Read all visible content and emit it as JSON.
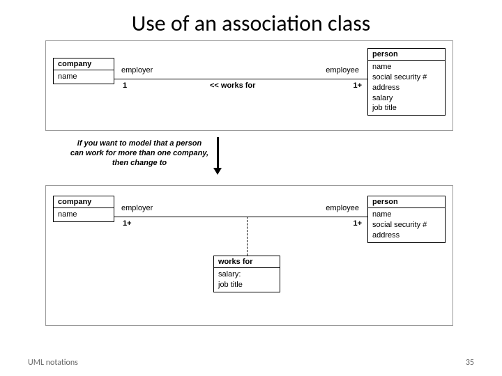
{
  "title": "Use of an association class",
  "diagram1": {
    "company": {
      "name": "company",
      "attrs": "name"
    },
    "person": {
      "name": "person",
      "attrs": "name\nsocial security #\naddress\nsalary\njob title"
    },
    "role_left": "employer",
    "mult_left": "1",
    "assoc_label": "<< works for",
    "role_right": "employee",
    "mult_right": "1+"
  },
  "transition_text": "if you want to model that\na person can work for\nmore than one company,\nthen change to",
  "diagram2": {
    "company": {
      "name": "company",
      "attrs": "name"
    },
    "person": {
      "name": "person",
      "attrs": "name\nsocial security #\naddress"
    },
    "works": {
      "name": "works for",
      "attrs": "salary:\njob title"
    },
    "role_left": "employer",
    "mult_left": "1+",
    "role_right": "employee",
    "mult_right": "1+"
  },
  "footer": {
    "left": "UML notations",
    "right": "35"
  }
}
